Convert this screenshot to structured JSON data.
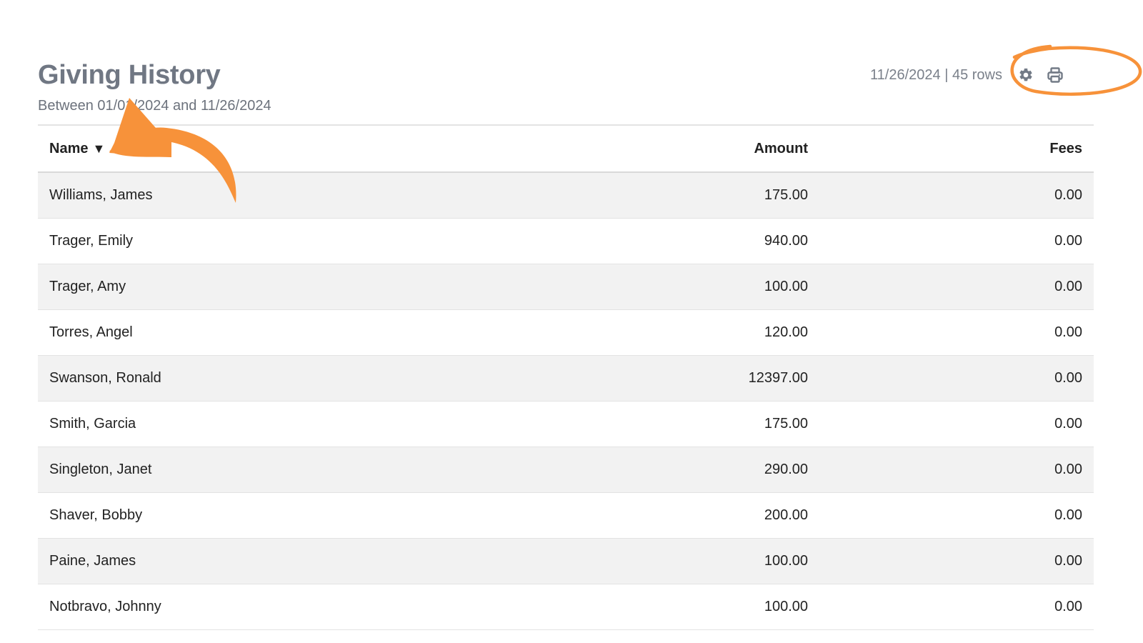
{
  "report": {
    "title": "Giving History",
    "subtitle": "Between 01/01/2024 and 11/26/2024",
    "meta": "11/26/2024 | 45 rows",
    "icons": [
      "gear-icon",
      "printer-icon"
    ]
  },
  "table": {
    "columns": {
      "name": "Name",
      "amount": "Amount",
      "fees": "Fees"
    },
    "sort_indicator": "▼",
    "rows": [
      {
        "name": "Williams, James",
        "amount": "175.00",
        "fees": "0.00"
      },
      {
        "name": "Trager, Emily",
        "amount": "940.00",
        "fees": "0.00"
      },
      {
        "name": "Trager, Amy",
        "amount": "100.00",
        "fees": "0.00"
      },
      {
        "name": "Torres, Angel",
        "amount": "120.00",
        "fees": "0.00"
      },
      {
        "name": "Swanson, Ronald",
        "amount": "12397.00",
        "fees": "0.00"
      },
      {
        "name": "Smith, Garcia",
        "amount": "175.00",
        "fees": "0.00"
      },
      {
        "name": "Singleton, Janet",
        "amount": "290.00",
        "fees": "0.00"
      },
      {
        "name": "Shaver, Bobby",
        "amount": "200.00",
        "fees": "0.00"
      },
      {
        "name": "Paine, James",
        "amount": "100.00",
        "fees": "0.00"
      },
      {
        "name": "Notbravo, Johnny",
        "amount": "100.00",
        "fees": "0.00"
      }
    ]
  },
  "colors": {
    "title": "#707783",
    "row_alt": "#f2f2f2",
    "annotation": "#f7923a"
  }
}
